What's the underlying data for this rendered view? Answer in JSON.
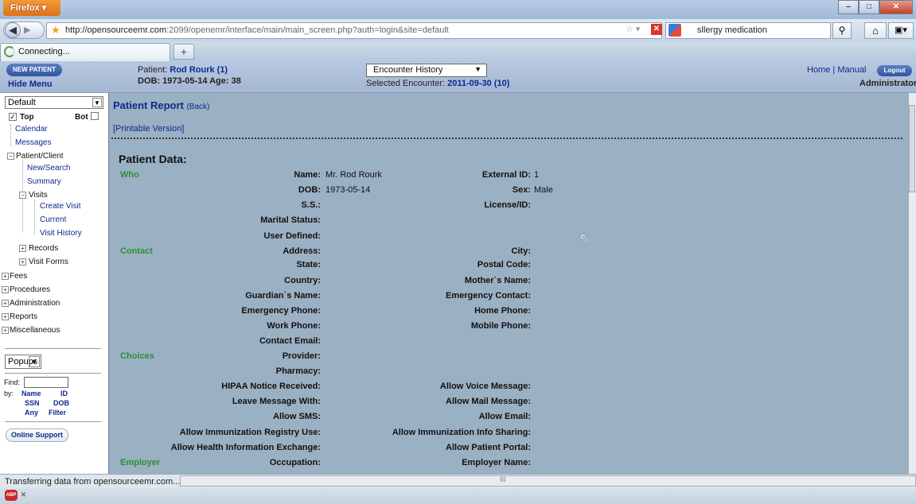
{
  "browser": {
    "menu_label": "Firefox",
    "url_host": "http://opensourceemr.com",
    "url_path": ":2099/openemr/interface/main/main_screen.php?auth=login&site=default",
    "search_text": "sllergy medication",
    "tab_label": "Connecting...",
    "newtab": "+",
    "status_text": "Transferring data from opensourceemr.com...",
    "hscroll_marker": "III"
  },
  "header": {
    "new_patient": "NEW PATIENT",
    "hide_menu": "Hide Menu",
    "patient_prefix": "Patient:",
    "patient_name": "Rod Rourk (1)",
    "dob_age": "DOB: 1973-05-14 Age: 38",
    "encounter_select": "Encounter History",
    "selected_prefix": "Selected Encounter:",
    "selected_encounter": "2011-09-30 (10)",
    "home": "Home",
    "separator": "|",
    "manual": "Manual",
    "logout": "Logout",
    "user": "Administrator"
  },
  "leftnav": {
    "select_value": "Default",
    "top": "Top",
    "bot": "Bot",
    "items": {
      "calendar": "Calendar",
      "messages": "Messages",
      "patient_client": "Patient/Client",
      "new_search": "New/Search",
      "summary": "Summary",
      "visits": "Visits",
      "create_visit": "Create Visit",
      "current": "Current",
      "visit_history": "Visit History",
      "records": "Records",
      "visit_forms": "Visit Forms",
      "fees": "Fees",
      "procedures": "Procedures",
      "administration": "Administration",
      "reports": "Reports",
      "miscellaneous": "Miscellaneous"
    },
    "popups": "Popups",
    "find_label": "Find:",
    "by_label": "by:",
    "find_name": "Name",
    "find_id": "ID",
    "find_ssn": "SSN",
    "find_dob": "DOB",
    "find_any": "Any",
    "find_filter": "Filter",
    "online_support": "Online Support"
  },
  "report": {
    "title": "Patient Report",
    "back": "(Back)",
    "printable": "[Printable Version]",
    "patient_data": "Patient Data:",
    "sections": {
      "who": "Who",
      "contact": "Contact",
      "choices": "Choices",
      "employer": "Employer"
    },
    "rows": [
      {
        "l1": "Name:",
        "v1": "Mr. Rod  Rourk",
        "l2": "External ID:",
        "v2": "1"
      },
      {
        "l1": "DOB:",
        "v1": "1973-05-14",
        "l2": "Sex:",
        "v2": "Male"
      },
      {
        "l1": "S.S.:",
        "v1": "",
        "l2": "License/ID:",
        "v2": ""
      },
      {
        "l1": "Marital Status:",
        "v1": "",
        "l2": "",
        "v2": ""
      },
      {
        "l1": "User Defined:",
        "v1": "",
        "l2": "",
        "v2": ""
      },
      {
        "l1": "Address:",
        "v1": "",
        "l2": "City:",
        "v2": ""
      },
      {
        "l1": "State:",
        "v1": "",
        "l2": "Postal Code:",
        "v2": ""
      },
      {
        "l1": "Country:",
        "v1": "",
        "l2": "Mother`s Name:",
        "v2": ""
      },
      {
        "l1": "Guardian`s Name:",
        "v1": "",
        "l2": "Emergency Contact:",
        "v2": ""
      },
      {
        "l1": "Emergency Phone:",
        "v1": "",
        "l2": "Home Phone:",
        "v2": ""
      },
      {
        "l1": "Work Phone:",
        "v1": "",
        "l2": "Mobile Phone:",
        "v2": ""
      },
      {
        "l1": "Contact Email:",
        "v1": "",
        "l2": "",
        "v2": ""
      },
      {
        "l1": "Provider:",
        "v1": "",
        "l2": "",
        "v2": ""
      },
      {
        "l1": "Pharmacy:",
        "v1": "",
        "l2": "",
        "v2": ""
      },
      {
        "l1": "HIPAA Notice Received:",
        "v1": "",
        "l2": "Allow Voice Message:",
        "v2": ""
      },
      {
        "l1": "Leave Message With:",
        "v1": "",
        "l2": "Allow Mail Message:",
        "v2": ""
      },
      {
        "l1": "Allow SMS:",
        "v1": "",
        "l2": "Allow Email:",
        "v2": ""
      },
      {
        "l1": "Allow Immunization Registry Use:",
        "v1": "",
        "l2": "Allow Immunization Info Sharing:",
        "v2": ""
      },
      {
        "l1": "Allow Health Information Exchange:",
        "v1": "",
        "l2": "Allow Patient Portal:",
        "v2": ""
      },
      {
        "l1": "Occupation:",
        "v1": "",
        "l2": "Employer Name:",
        "v2": ""
      }
    ]
  }
}
